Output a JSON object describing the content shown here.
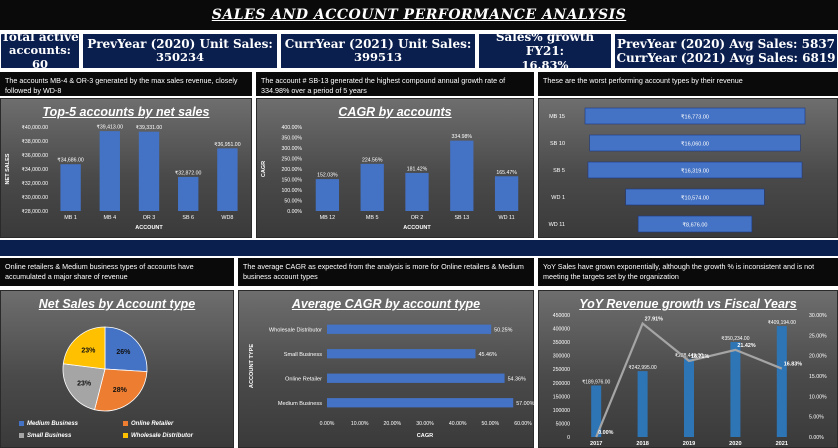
{
  "header": {
    "title": "SALES AND ACCOUNT PERFORMANCE ANALYSIS"
  },
  "kpis": [
    {
      "line1": "Total active",
      "line2": "accounts: 60"
    },
    {
      "line1": "PrevYear (2020) Unit Sales:",
      "line2": "350234"
    },
    {
      "line1": "CurrYear (2021) Unit Sales:",
      "line2": "399513"
    },
    {
      "line1": "Sales% growth FY21:",
      "line2": "16.83%"
    },
    {
      "line1": "PrevYear (2020) Avg Sales: 5837",
      "line2": "CurrYear (2021) Avg Sales: 6819"
    }
  ],
  "captions": {
    "top_accounts": "The accounts MB-4 & OR-3 generated by the max sales revenue, closely followed by WD-8",
    "cagr_accounts": "The account # SB-13 generated the highest compound annual growth rate of 334.98% over a period of 5 years",
    "worst_accounts": "These are the worst performing account types by their revenue",
    "net_sales_type": "Online retailers & Medium business types of accounts have accumulated a major share of revenue",
    "avg_cagr_type": "The average CAGR as expected from the analysis is more for Online retailers & Medium business account types",
    "yoy": "YoY Sales have grown exponentially, although the growth % is inconsistent and is not meeting the targets set by the organization"
  },
  "chart_data": [
    {
      "id": "top5",
      "type": "bar",
      "title": "Top-5 accounts by net sales",
      "xlabel": "ACCOUNT",
      "ylabel": "NET SALES",
      "categories": [
        "MB 1",
        "MB 4",
        "OR 3",
        "SB 6",
        "WD8"
      ],
      "values": [
        34686,
        39413,
        39331,
        32872,
        36951
      ],
      "value_labels": [
        "₹34,686.00",
        "₹39,413.00",
        "₹39,331.00",
        "₹32,872.00",
        "₹36,951.00"
      ],
      "ylim": [
        28000,
        40000
      ],
      "yticks": [
        "₹28,000.00",
        "₹30,000.00",
        "₹32,000.00",
        "₹34,000.00",
        "₹36,000.00",
        "₹38,000.00",
        "₹40,000.00"
      ]
    },
    {
      "id": "cagr",
      "type": "bar",
      "title": "CAGR by accounts",
      "xlabel": "ACCOUNT",
      "ylabel": "CAGR",
      "categories": [
        "MB 12",
        "MB 5",
        "OR 2",
        "SB 13",
        "WD 11"
      ],
      "values": [
        152.03,
        224.56,
        181.42,
        334.98,
        165.47
      ],
      "value_labels": [
        "152.03%",
        "224.56%",
        "181.42%",
        "334.98%",
        "165.47%"
      ],
      "ylim": [
        0,
        400
      ],
      "yticks": [
        "0.00%",
        "50.00%",
        "100.00%",
        "150.00%",
        "200.00%",
        "250.00%",
        "300.00%",
        "350.00%",
        "400.00%"
      ]
    },
    {
      "id": "worst",
      "type": "bar",
      "orientation": "funnel",
      "categories": [
        "MB 15",
        "SB 10",
        "SB 5",
        "WD 1",
        "WD 11"
      ],
      "values": [
        16773,
        16060,
        16319,
        10574,
        8676
      ],
      "value_labels": [
        "₹16,773.00",
        "₹16,060.00",
        "₹16,319.00",
        "₹10,574.00",
        "₹8,676.00"
      ]
    },
    {
      "id": "pie",
      "type": "pie",
      "title": "Net Sales by Account type",
      "categories": [
        "Medium Business",
        "Online Retailer",
        "Small Business",
        "Wholesale Distributor"
      ],
      "values": [
        26,
        28,
        23,
        23
      ],
      "value_labels": [
        "26%",
        "28%",
        "23%",
        "23%"
      ],
      "colors": [
        "#4472c4",
        "#ed7d31",
        "#a5a5a5",
        "#ffc000"
      ]
    },
    {
      "id": "avgcagr",
      "type": "bar",
      "orientation": "horizontal",
      "title": "Average CAGR by account type",
      "xlabel": "CAGR",
      "ylabel": "ACCOUNT TYPE",
      "categories": [
        "Wholesale Distributor",
        "Small Business",
        "Online Retailer",
        "Medium Business"
      ],
      "values": [
        50.25,
        45.46,
        54.36,
        57.0
      ],
      "value_labels": [
        "50.25%",
        "45.46%",
        "54.36%",
        "57.00%"
      ],
      "xlim": [
        0,
        60
      ],
      "xticks": [
        "0.00%",
        "10.00%",
        "20.00%",
        "30.00%",
        "40.00%",
        "50.00%",
        "60.00%"
      ]
    },
    {
      "id": "yoy",
      "type": "bar",
      "title": "YoY Revenue growth vs Fiscal Years",
      "categories": [
        "2017",
        "2018",
        "2019",
        "2020",
        "2021"
      ],
      "values": [
        189976,
        242995,
        288449,
        350234,
        409194
      ],
      "value_labels": [
        "₹189,976.00",
        "₹242,995.00",
        "₹288,449.00",
        "₹350,234.00",
        "₹409,194.00"
      ],
      "growth": [
        0,
        27.91,
        18.71,
        21.42,
        16.83
      ],
      "growth_labels": [
        "0.00%",
        "27.91%",
        "18.71%",
        "21.42%",
        "16.83%"
      ],
      "ylim": [
        0,
        450000
      ],
      "yticks": [
        "0",
        "50000",
        "100000",
        "150000",
        "200000",
        "250000",
        "300000",
        "350000",
        "400000",
        "450000"
      ],
      "y2lim": [
        0,
        30
      ],
      "y2ticks": [
        "0.00%",
        "5.00%",
        "10.00%",
        "15.00%",
        "20.00%",
        "25.00%",
        "30.00%"
      ]
    }
  ],
  "colors": {
    "bar": "#4472c4",
    "header": "#0b1f4f",
    "caption_bg": "#0a0a0a",
    "line": "#a5a5a5"
  }
}
